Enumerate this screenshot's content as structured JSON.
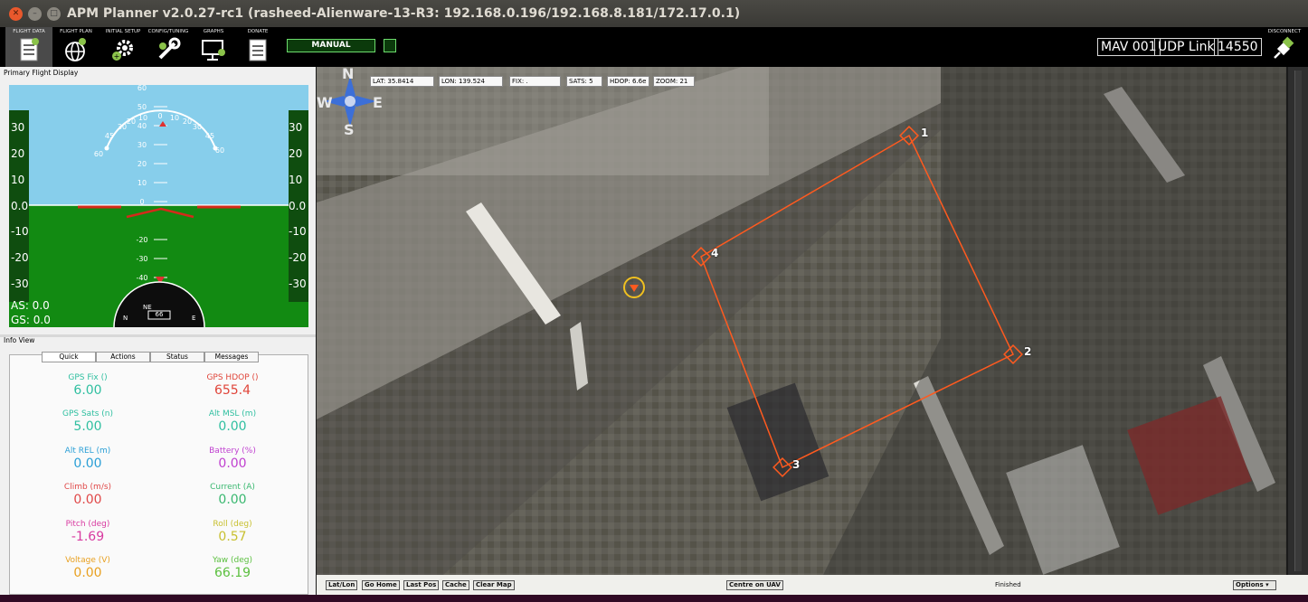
{
  "window": {
    "title": "APM Planner v2.0.27-rc1 (rasheed-Alienware-13-R3: 192.168.0.196/192.168.8.181/172.17.0.1)"
  },
  "toolbar": {
    "items": [
      {
        "label": "FLIGHT DATA",
        "icon": "clipboard-icon"
      },
      {
        "label": "FLIGHT PLAN",
        "icon": "globe-icon"
      },
      {
        "label": "INITIAL SETUP",
        "icon": "gears-icon"
      },
      {
        "label": "CONFIG/TUNING",
        "icon": "wrench-icon"
      },
      {
        "label": "GRAPHS",
        "icon": "monitor-icon"
      },
      {
        "label": "DONATE",
        "icon": "document-icon"
      }
    ],
    "mode": "MANUAL",
    "mav": "MAV 001",
    "link": "UDP Link",
    "port": "14550",
    "disconnect": "DISCONNECT"
  },
  "pfd": {
    "title": "Primary Flight Display",
    "left_tape": [
      "30",
      "20",
      "10",
      "0.0",
      "-10",
      "-20",
      "-30"
    ],
    "right_tape": [
      "30",
      "20",
      "10",
      "0.0",
      "-10",
      "-20",
      "-30"
    ],
    "pitch_up": [
      "60",
      "50",
      "40",
      "30",
      "20",
      "10",
      "0"
    ],
    "pitch_down": [
      "-20",
      "-30",
      "-40"
    ],
    "roll_left": [
      "60",
      "45",
      "30",
      "20",
      "10"
    ],
    "roll_right": [
      "0",
      "10",
      "20",
      "30",
      "45",
      "60"
    ],
    "as": "AS: 0.0",
    "gs": "GS: 0.0",
    "heading": "66",
    "compass_letters": [
      "NE",
      "E",
      "N"
    ]
  },
  "info": {
    "title": "Info View",
    "tabs": [
      "Quick",
      "Actions",
      "Status",
      "Messages"
    ],
    "cells": [
      {
        "key": "GPS Fix ()",
        "value": "6.00",
        "color": "#2fbfa0"
      },
      {
        "key": "GPS HDOP ()",
        "value": "655.4",
        "color": "#e0453a"
      },
      {
        "key": "GPS Sats (n)",
        "value": "5.00",
        "color": "#2fbfa0"
      },
      {
        "key": "Alt MSL (m)",
        "value": "0.00",
        "color": "#2fbfa0"
      },
      {
        "key": "Alt REL (m)",
        "value": "0.00",
        "color": "#2a9fd6"
      },
      {
        "key": "Battery (%)",
        "value": "0.00",
        "color": "#c040d0"
      },
      {
        "key": "Climb (m/s)",
        "value": "0.00",
        "color": "#e04848"
      },
      {
        "key": "Current (A)",
        "value": "0.00",
        "color": "#3ab870"
      },
      {
        "key": "Pitch (deg)",
        "value": "-1.69",
        "color": "#d83aa0"
      },
      {
        "key": "Roll (deg)",
        "value": "0.57",
        "color": "#c8c030"
      },
      {
        "key": "Voltage (V)",
        "value": "0.00",
        "color": "#e8a020"
      },
      {
        "key": "Yaw (deg)",
        "value": "66.19",
        "color": "#5cc040"
      }
    ]
  },
  "map": {
    "lat": "LAT: 35.8414",
    "lon": "LON: 139.524",
    "fix": "FIX: .",
    "sats": "SATS: 5",
    "hdop": "HDOP: 6.6e",
    "zoom": "ZOOM: 21",
    "compass": {
      "n": "N",
      "s": "S",
      "e": "E",
      "w": "W"
    },
    "waypoints": [
      "1",
      "2",
      "3",
      "4"
    ],
    "route_color": "#ff5a1f"
  },
  "bottom": {
    "latlon": "Lat/Lon",
    "go_home": "Go Home",
    "last_pos": "Last Pos",
    "cache": "Cache",
    "clear_map": "Clear Map",
    "centre": "Centre on UAV",
    "status": "Finished",
    "options": "Options"
  }
}
